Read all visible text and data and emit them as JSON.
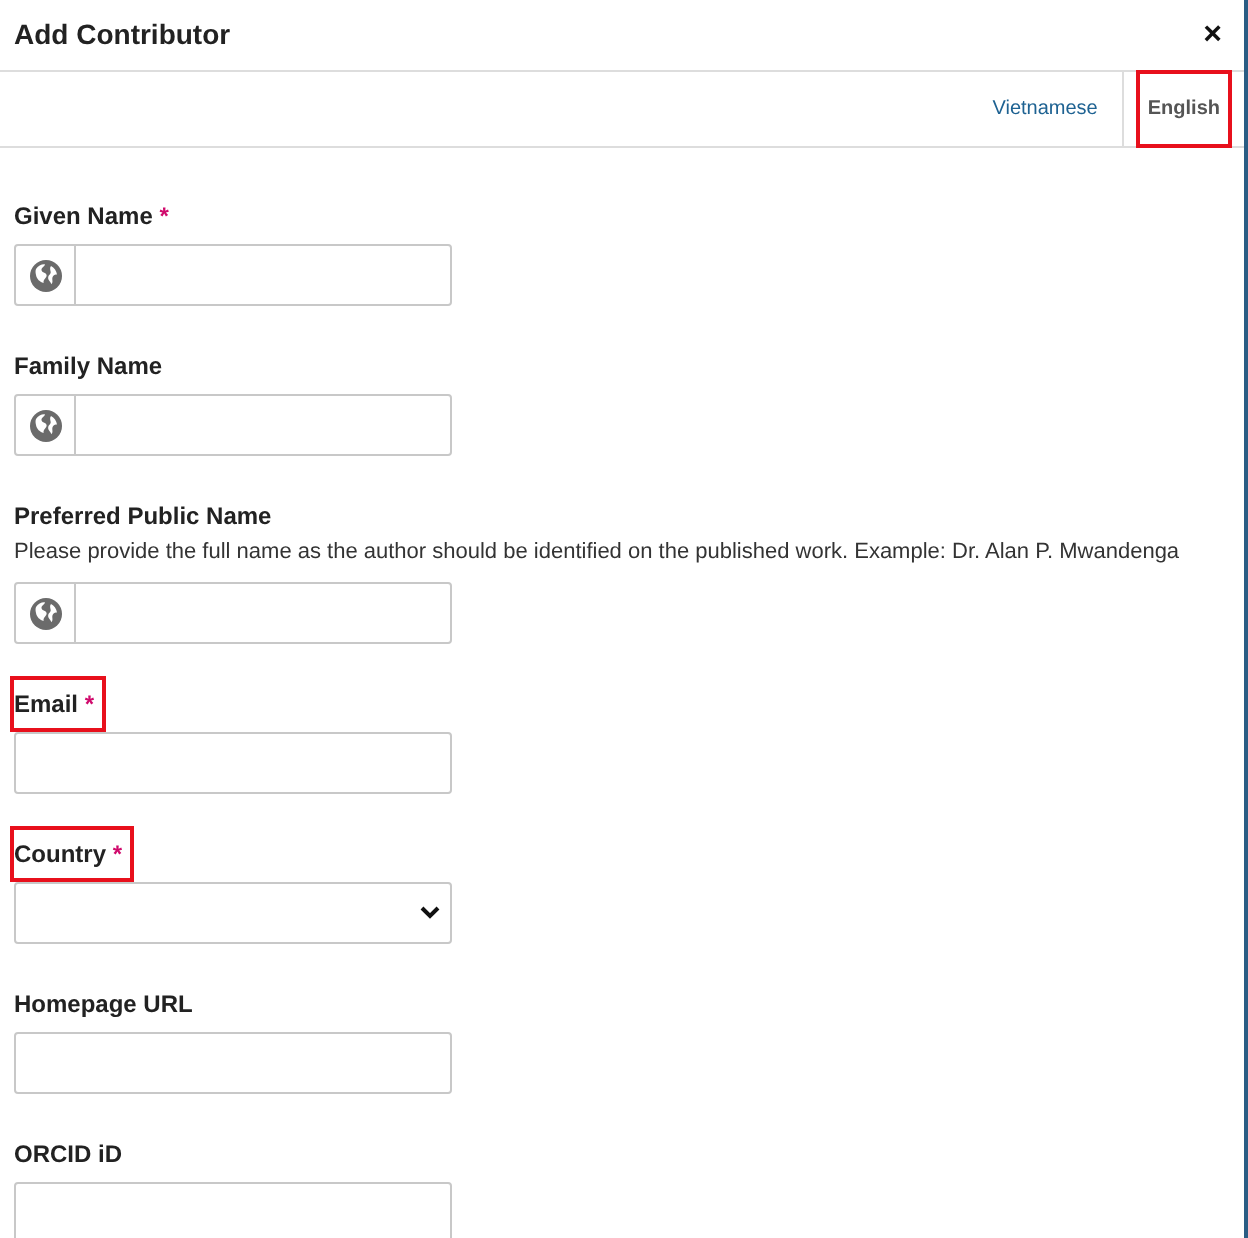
{
  "dialog": {
    "title": "Add Contributor",
    "close": "×"
  },
  "languages": [
    {
      "label": "Vietnamese",
      "selected": false,
      "highlighted": false
    },
    {
      "label": "English",
      "selected": true,
      "highlighted": true
    }
  ],
  "fields": [
    {
      "kind": "multilingual",
      "label": "Given Name",
      "required_mark": "*",
      "highlighted": false
    },
    {
      "kind": "multilingual",
      "label": "Family Name",
      "highlighted": false
    },
    {
      "kind": "multilingual",
      "label": "Preferred Public Name",
      "highlighted": false,
      "description": "Please provide the full name as the author should be identified on the published work. Example: Dr. Alan P. Mwandenga"
    },
    {
      "kind": "text",
      "label": "Email",
      "required_mark": "*",
      "highlighted": true
    },
    {
      "kind": "select",
      "label": "Country",
      "required_mark": "*",
      "highlighted": true
    },
    {
      "kind": "text",
      "label": "Homepage URL",
      "highlighted": false
    },
    {
      "kind": "text",
      "label": "ORCID iD",
      "highlighted": false
    }
  ]
}
